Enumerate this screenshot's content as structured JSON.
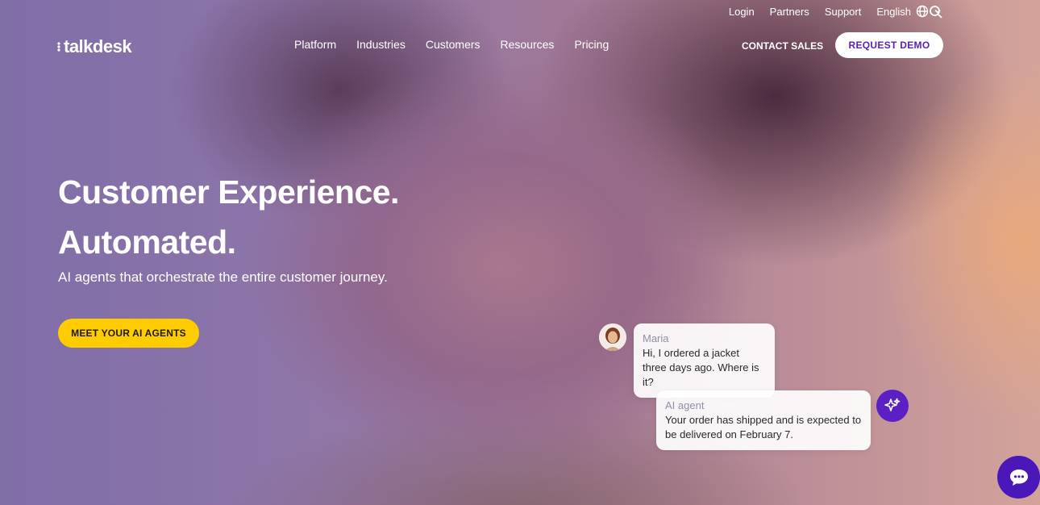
{
  "utility": {
    "login": "Login",
    "partners": "Partners",
    "support": "Support",
    "language": "English"
  },
  "brand": {
    "name": "talkdesk"
  },
  "nav": {
    "items": [
      "Platform",
      "Industries",
      "Customers",
      "Resources",
      "Pricing"
    ]
  },
  "header": {
    "contact_sales": "CONTACT SALES",
    "request_demo": "REQUEST DEMO"
  },
  "hero": {
    "headline_line1": "Customer Experience.",
    "headline_line2": "Automated.",
    "subhead": "AI agents that orchestrate the entire customer journey.",
    "cta": "MEET YOUR AI AGENTS"
  },
  "chat": {
    "customer_name": "Maria",
    "customer_message": "Hi, I ordered a jacket three days ago. Where is it?",
    "agent_name": "AI agent",
    "agent_message": "Your order has shipped and is expected to be delivered on February 7."
  },
  "colors": {
    "accent_purple": "#5a1fb5",
    "cta_yellow": "#ffcc00"
  },
  "icons": {
    "globe": "globe-icon",
    "chevron": "chevron-down-icon",
    "search": "search-icon",
    "sparkle": "sparkle-icon",
    "chat": "chat-bubble-icon"
  }
}
